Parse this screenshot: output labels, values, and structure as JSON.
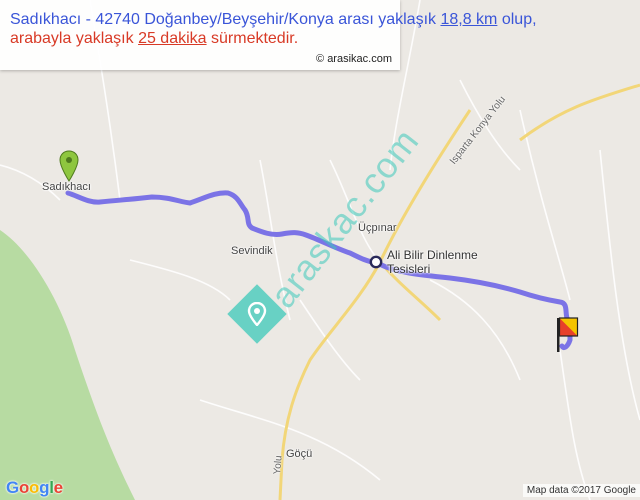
{
  "info": {
    "line1_a": "Sadıkhacı - 42740 Doğanbey/Beyşehir/Konya arası yaklaşık ",
    "distance": "18,8 km",
    "line1_b": " olup,",
    "line2_a": "arabayla yaklaşık ",
    "duration": "25 dakika",
    "line2_b": " sürmektedir.",
    "copyright": "© arasikac.com"
  },
  "places": {
    "sadikhaci": "Sadıkhacı",
    "sevindik": "Sevindik",
    "ucpinar": "Üçpınar",
    "ali_bilir": "Ali Bilir Dinlenme",
    "tesisleri": "Tesisleri",
    "gocu": "Göçü"
  },
  "roads": {
    "isparta_konya_yolu": "Isparta Konya Yolu",
    "yolu": "Yolu"
  },
  "watermark": "araskac.com",
  "footer": {
    "google": [
      "G",
      "o",
      "o",
      "g",
      "l",
      "e"
    ],
    "map_data": "Map data ©2017 Google"
  },
  "colors": {
    "route": "#7b73e6",
    "highway": "#f2d678",
    "green_area": "#b7dba2",
    "origin_marker": "#8ec63f",
    "info_blue": "#3a55d8",
    "info_red": "#d83a26"
  },
  "icons": {
    "origin": "green-pin-marker",
    "destination": "checkered-flag-marker",
    "waypoint": "circle-waypoint-marker"
  }
}
